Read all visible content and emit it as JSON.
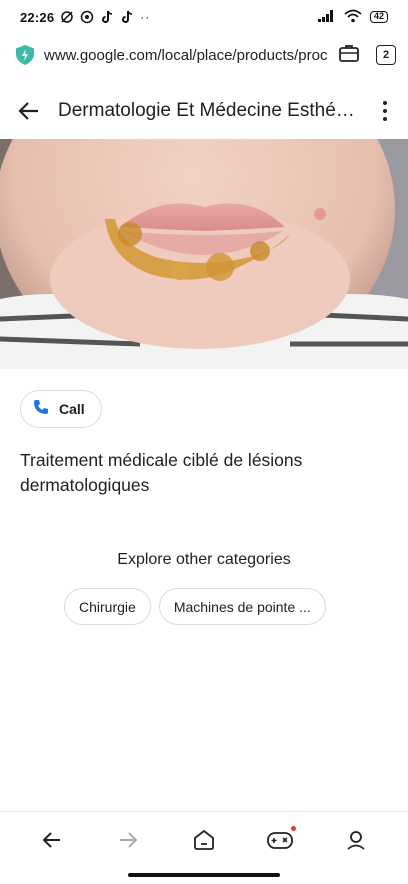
{
  "status_bar": {
    "time": "22:26",
    "battery": "42",
    "overflow": "··"
  },
  "browser": {
    "url": "www.google.com/local/place/products/proc",
    "tab_count": "2"
  },
  "header": {
    "title": "Dermatologie Et Médecine Esthéti..."
  },
  "actions": {
    "call_label": "Call"
  },
  "content": {
    "description": "Traitement médicale ciblé de lésions dermatologiques",
    "explore_title": "Explore other categories",
    "categories": [
      "Chirurgie",
      "Machines de pointe ..."
    ]
  },
  "colors": {
    "shield": "#3fb8a9",
    "call_icon": "#1a73e8",
    "notification_dot": "#e53935"
  },
  "icons": {
    "back": "arrow-left-icon",
    "forward": "arrow-right-icon",
    "home": "home-icon",
    "games": "gamepad-icon",
    "profile": "profile-icon"
  }
}
